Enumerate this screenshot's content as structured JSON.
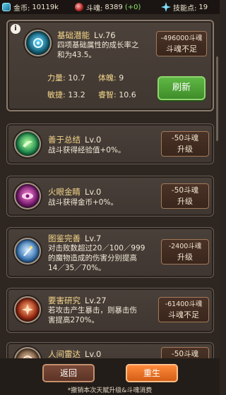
{
  "topbar": {
    "coins_label": "金币:",
    "coins_value": "10119k",
    "soul_label": "斗魂:",
    "soul_value": "8389",
    "soul_delta": "(+0)",
    "skill_points_label": "技能点:",
    "skill_points_value": "19"
  },
  "main_skill": {
    "name": "基础潜能",
    "level": "Lv.76",
    "desc_line1": "四项基础属性的成长率之",
    "desc_line2": "和为43.5。",
    "cost": "-496000斗魂",
    "status": "斗魂不足",
    "refresh_label": "刷新",
    "stats": [
      {
        "label": "力量:",
        "value": "10.7"
      },
      {
        "label": "体魄:",
        "value": "9"
      },
      {
        "label": "敏捷:",
        "value": "13.2"
      },
      {
        "label": "睿智:",
        "value": "10.6"
      }
    ]
  },
  "skills": [
    {
      "name": "善于总结",
      "level": "Lv.0",
      "desc": [
        "战斗获得经验值+0%。"
      ],
      "cost": "-50斗魂",
      "action": "升级"
    },
    {
      "name": "火眼金睛",
      "level": "Lv.0",
      "desc": [
        "战斗获得金币+0%。"
      ],
      "cost": "-50斗魂",
      "action": "升级"
    },
    {
      "name": "图鉴完善",
      "level": "Lv.7",
      "desc": [
        "对击败数超过20／100／999",
        "的魔物造成的伤害分别提高",
        "14／35／70%。"
      ],
      "cost": "-2400斗魂",
      "action": "升级"
    },
    {
      "name": "要害研究",
      "level": "Lv.27",
      "desc": [
        "若攻击产生暴击，则暴击伤",
        "害提高270%。"
      ],
      "cost": "-61400斗魂",
      "action": "斗魂不足"
    },
    {
      "name": "人间雷达",
      "level": "Lv.0",
      "desc": [],
      "cost": "-50斗魂",
      "action": ""
    }
  ],
  "bottom": {
    "back_label": "返回",
    "reborn_label": "重生",
    "footnote": "*撤销本次天赋升级&斗魂消费"
  },
  "colors": {
    "accent_green": "#8de46a",
    "title_gold": "#f4d68a",
    "reborn_orange": "#ff8a3a"
  }
}
